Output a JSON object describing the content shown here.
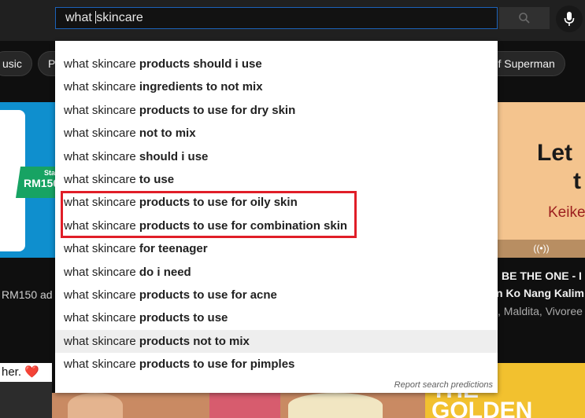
{
  "search": {
    "query_before_caret": "what ",
    "query_after_caret": "skincare"
  },
  "chips": {
    "left1": "usic",
    "left2": "P",
    "right": "n of Superman"
  },
  "cards": {
    "left_badge_top": "Sta",
    "left_badge_price": "RM150",
    "left_ad_text": "RM150 ad (",
    "right_poster_line1": "Let",
    "right_poster_line2": "t",
    "right_poster_name": "Keike",
    "right_live_icon": "((•))",
    "right_title1": "BE THE ONE - I",
    "right_title2": "n Ko Nang Kalim",
    "right_sub": ", Maldita, Vivoree",
    "bottom_left_text": "her. ❤️",
    "bottom_right_title": "THE",
    "bottom_right_title2": "GOLDEN"
  },
  "suggestions": [
    {
      "prefix": "what skincare ",
      "bold": "products should i use"
    },
    {
      "prefix": "what skincare ",
      "bold": "ingredients to not mix"
    },
    {
      "prefix": "what skincare ",
      "bold": "products to use for dry skin"
    },
    {
      "prefix": "what skincare ",
      "bold": "not to mix"
    },
    {
      "prefix": "what skincare ",
      "bold": "should i use"
    },
    {
      "prefix": "what skincare ",
      "bold": "to use"
    },
    {
      "prefix": "what skincare ",
      "bold": "products to use for oily skin"
    },
    {
      "prefix": "what skincare ",
      "bold": "products to use for combination skin"
    },
    {
      "prefix": "what skincare ",
      "bold": "for teenager"
    },
    {
      "prefix": "what skincare ",
      "bold": "do i need"
    },
    {
      "prefix": "what skincare ",
      "bold": "products to use for acne"
    },
    {
      "prefix": "what skincare ",
      "bold": "products to use"
    },
    {
      "prefix": "what skincare ",
      "bold": "products not to mix"
    },
    {
      "prefix": "what skincare ",
      "bold": "products to use for pimples"
    }
  ],
  "report_text": "Report search predictions",
  "icons": {
    "search": "search-icon",
    "mic": "microphone-icon"
  },
  "colors": {
    "highlight_box": "#e01e28",
    "search_focus": "#1c62b9"
  }
}
